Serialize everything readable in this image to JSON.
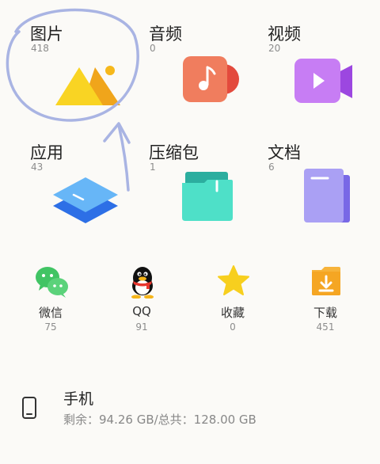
{
  "categories": [
    {
      "label": "图片",
      "count": "418",
      "icon": "image-icon"
    },
    {
      "label": "音频",
      "count": "0",
      "icon": "audio-icon"
    },
    {
      "label": "视频",
      "count": "20",
      "icon": "video-icon"
    },
    {
      "label": "应用",
      "count": "43",
      "icon": "apps-icon"
    },
    {
      "label": "压缩包",
      "count": "1",
      "icon": "archive-icon"
    },
    {
      "label": "文档",
      "count": "6",
      "icon": "document-icon"
    }
  ],
  "apps": [
    {
      "label": "微信",
      "count": "75",
      "icon": "wechat-icon"
    },
    {
      "label": "QQ",
      "count": "91",
      "icon": "qq-icon"
    },
    {
      "label": "收藏",
      "count": "0",
      "icon": "star-icon"
    },
    {
      "label": "下载",
      "count": "451",
      "icon": "download-icon"
    }
  ],
  "storage": {
    "title": "手机",
    "info": "剩余：94.26 GB/总共：128.00 GB",
    "icon": "phone-icon"
  },
  "colors": {
    "annotation": "#a9b4e3",
    "image_yellow": "#f7d21f",
    "audio_red": "#ef6a4f",
    "video_purple": "#c06cf0",
    "apps_blue": "#3a86f0",
    "archive_teal": "#3fd6c0",
    "doc_purple": "#9b8ef0",
    "wechat_green": "#3cc65a",
    "star_yellow": "#f7cf1e",
    "download_orange": "#f5a623"
  }
}
